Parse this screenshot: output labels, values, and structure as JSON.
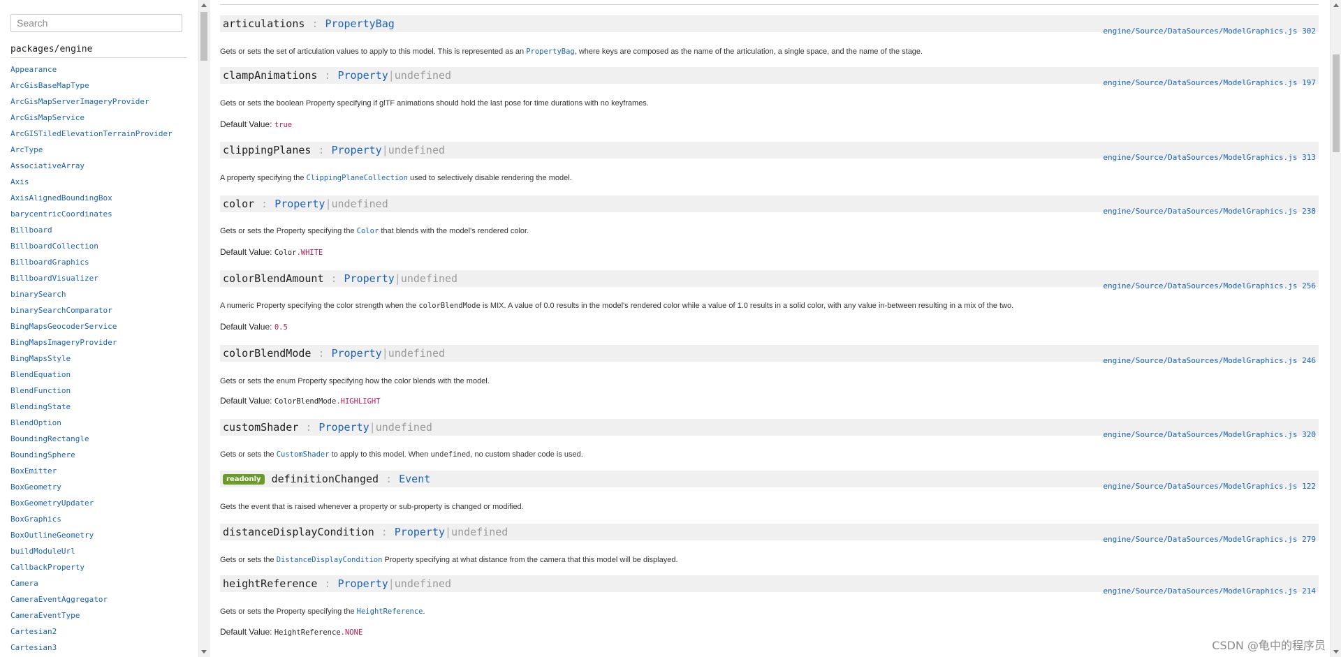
{
  "sidebar": {
    "search_placeholder": "Search",
    "package_title": "packages/engine",
    "items": [
      "Appearance",
      "ArcGisBaseMapType",
      "ArcGisMapServerImageryProvider",
      "ArcGisMapService",
      "ArcGISTiledElevationTerrainProvider",
      "ArcType",
      "AssociativeArray",
      "Axis",
      "AxisAlignedBoundingBox",
      "barycentricCoordinates",
      "Billboard",
      "BillboardCollection",
      "BillboardGraphics",
      "BillboardVisualizer",
      "binarySearch",
      "binarySearchComparator",
      "BingMapsGeocoderService",
      "BingMapsImageryProvider",
      "BingMapsStyle",
      "BlendEquation",
      "BlendFunction",
      "BlendingState",
      "BlendOption",
      "BoundingRectangle",
      "BoundingSphere",
      "BoxEmitter",
      "BoxGeometry",
      "BoxGeometryUpdater",
      "BoxGraphics",
      "BoxOutlineGeometry",
      "buildModuleUrl",
      "CallbackProperty",
      "Camera",
      "CameraEventAggregator",
      "CameraEventType",
      "Cartesian2",
      "Cartesian3"
    ]
  },
  "members": [
    {
      "name": "articulations",
      "sep": ":",
      "type": "PropertyBag",
      "pipe": "",
      "undef": "",
      "readonly": "",
      "source": "engine/Source/DataSources/ModelGraphics.js 302",
      "desc": [
        {
          "t": "text",
          "v": "Gets or sets the set of articulation values to apply to this model. This is represented as an "
        },
        {
          "t": "link",
          "v": "PropertyBag"
        },
        {
          "t": "text",
          "v": ", where keys are composed as the name of the articulation, a single space, and the name of the stage."
        }
      ],
      "default_label": "",
      "default_plain": "",
      "default_hl": ""
    },
    {
      "name": "clampAnimations",
      "sep": ":",
      "type": "Property",
      "pipe": "|",
      "undef": "undefined",
      "readonly": "",
      "source": "engine/Source/DataSources/ModelGraphics.js 197",
      "desc": [
        {
          "t": "text",
          "v": "Gets or sets the boolean Property specifying if glTF animations should hold the last pose for time durations with no keyframes."
        }
      ],
      "default_label": "Default Value: ",
      "default_plain": "",
      "default_hl": "true"
    },
    {
      "name": "clippingPlanes",
      "sep": ":",
      "type": "Property",
      "pipe": "|",
      "undef": "undefined",
      "readonly": "",
      "source": "engine/Source/DataSources/ModelGraphics.js 313",
      "desc": [
        {
          "t": "text",
          "v": "A property specifying the "
        },
        {
          "t": "link",
          "v": "ClippingPlaneCollection"
        },
        {
          "t": "text",
          "v": " used to selectively disable rendering the model."
        }
      ],
      "default_label": "",
      "default_plain": "",
      "default_hl": ""
    },
    {
      "name": "color",
      "sep": ":",
      "type": "Property",
      "pipe": "|",
      "undef": "undefined",
      "readonly": "",
      "source": "engine/Source/DataSources/ModelGraphics.js 238",
      "desc": [
        {
          "t": "text",
          "v": "Gets or sets the Property specifying the "
        },
        {
          "t": "link",
          "v": "Color"
        },
        {
          "t": "text",
          "v": " that blends with the model's rendered color."
        }
      ],
      "default_label": "Default Value: ",
      "default_plain": "Color",
      "default_hl": ".WHITE"
    },
    {
      "name": "colorBlendAmount",
      "sep": ":",
      "type": "Property",
      "pipe": "|",
      "undef": "undefined",
      "readonly": "",
      "source": "engine/Source/DataSources/ModelGraphics.js 256",
      "desc": [
        {
          "t": "text",
          "v": "A numeric Property specifying the color strength when the "
        },
        {
          "t": "code",
          "v": "colorBlendMode"
        },
        {
          "t": "text",
          "v": " is MIX. A value of 0.0 results in the model's rendered color while a value of 1.0 results in a solid color, with any value in-between resulting in a mix of the two."
        }
      ],
      "default_label": "Default Value: ",
      "default_plain": "",
      "default_hl": "0.5"
    },
    {
      "name": "colorBlendMode",
      "sep": ":",
      "type": "Property",
      "pipe": "|",
      "undef": "undefined",
      "readonly": "",
      "source": "engine/Source/DataSources/ModelGraphics.js 246",
      "desc": [
        {
          "t": "text",
          "v": "Gets or sets the enum Property specifying how the color blends with the model."
        }
      ],
      "default_label": "Default Value: ",
      "default_plain": "ColorBlendMode",
      "default_hl": ".HIGHLIGHT"
    },
    {
      "name": "customShader",
      "sep": ":",
      "type": "Property",
      "pipe": "|",
      "undef": "undefined",
      "readonly": "",
      "source": "engine/Source/DataSources/ModelGraphics.js 320",
      "desc": [
        {
          "t": "text",
          "v": "Gets or sets the "
        },
        {
          "t": "link",
          "v": "CustomShader"
        },
        {
          "t": "text",
          "v": " to apply to this model. When "
        },
        {
          "t": "code",
          "v": "undefined"
        },
        {
          "t": "text",
          "v": ", no custom shader code is used."
        }
      ],
      "default_label": "",
      "default_plain": "",
      "default_hl": ""
    },
    {
      "name": "definitionChanged",
      "sep": ":",
      "type": "Event",
      "pipe": "",
      "undef": "",
      "readonly": "readonly",
      "source": "engine/Source/DataSources/ModelGraphics.js 122",
      "desc": [
        {
          "t": "text",
          "v": "Gets the event that is raised whenever a property or sub-property is changed or modified."
        }
      ],
      "default_label": "",
      "default_plain": "",
      "default_hl": ""
    },
    {
      "name": "distanceDisplayCondition",
      "sep": ":",
      "type": "Property",
      "pipe": "|",
      "undef": "undefined",
      "readonly": "",
      "source": "engine/Source/DataSources/ModelGraphics.js 279",
      "desc": [
        {
          "t": "text",
          "v": "Gets or sets the "
        },
        {
          "t": "link",
          "v": "DistanceDisplayCondition"
        },
        {
          "t": "text",
          "v": " Property specifying at what distance from the camera that this model will be displayed."
        }
      ],
      "default_label": "",
      "default_plain": "",
      "default_hl": ""
    },
    {
      "name": "heightReference",
      "sep": ":",
      "type": "Property",
      "pipe": "|",
      "undef": "undefined",
      "readonly": "",
      "source": "engine/Source/DataSources/ModelGraphics.js 214",
      "desc": [
        {
          "t": "text",
          "v": "Gets or sets the Property specifying the "
        },
        {
          "t": "link",
          "v": "HeightReference"
        },
        {
          "t": "text",
          "v": "."
        }
      ],
      "default_label": "Default Value: ",
      "default_plain": "HeightReference",
      "default_hl": ".NONE"
    }
  ],
  "watermark": "CSDN @龟中的程序员"
}
